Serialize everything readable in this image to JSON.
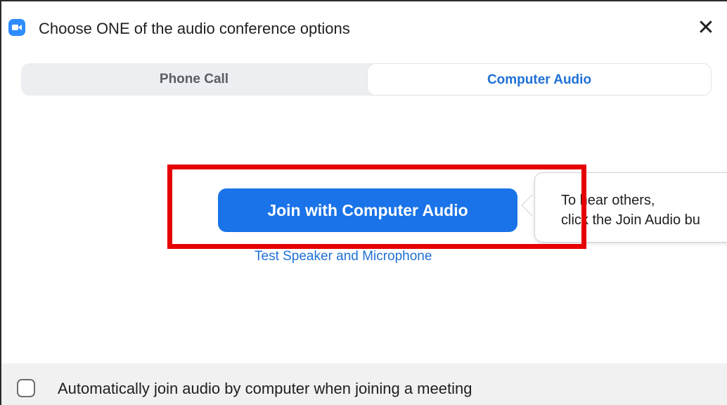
{
  "window": {
    "title": "Choose ONE of the audio conference options",
    "close_glyph": "✕"
  },
  "tabs": [
    {
      "label": "Phone Call",
      "selected": false
    },
    {
      "label": "Computer Audio",
      "selected": true
    }
  ],
  "main": {
    "join_button_label": "Join with Computer Audio",
    "test_link_label": "Test Speaker and Microphone"
  },
  "tooltip": {
    "line1": "To hear others,",
    "line2": "click the Join Audio bu"
  },
  "footer": {
    "auto_join_label": "Automatically join audio by computer when joining a meeting",
    "auto_join_checked": false
  },
  "colors": {
    "accent": "#1a73e8",
    "link": "#1f71d6",
    "highlight": "#e60000",
    "app_icon": "#2d8cff"
  },
  "icons": {
    "app": "zoom-camera-icon",
    "close": "close-icon"
  }
}
